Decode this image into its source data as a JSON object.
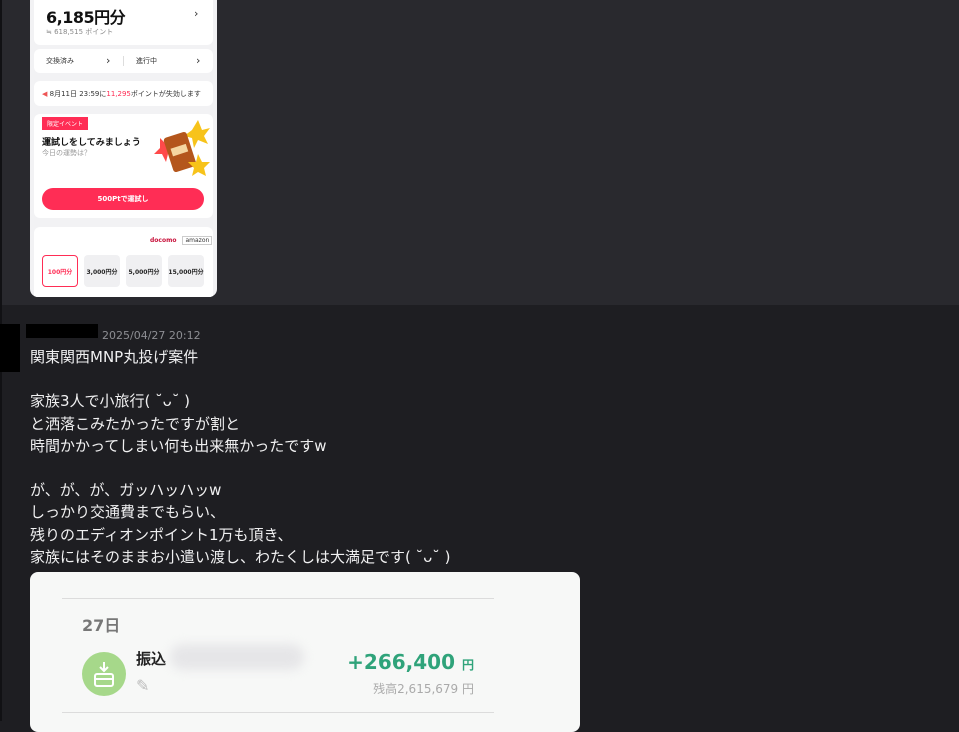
{
  "phone": {
    "balance_amount": "6,185円分",
    "balance_points": "≒ 618,515 ポイント",
    "exchanged_label": "交換済み",
    "in_progress_label": "進行中",
    "expiry_prefix": "8月11日 23:59に",
    "expiry_points": "11,295",
    "expiry_suffix": "ポイントが失効します",
    "event_tag": "限定イベント",
    "event_title": "運試しをしてみましょう",
    "event_sub": "今日の運勢は？",
    "event_button": "500Ptで運試し",
    "logo_docomo": "docomo",
    "logo_amazon": "amazon",
    "options": [
      "100円分",
      "3,000円分",
      "5,000円分",
      "15,000円分"
    ]
  },
  "message": {
    "timestamp": "2025/04/27 20:12",
    "lines": [
      "関東関西MNP丸投げ案件",
      "",
      "家族3人で小旅行( ˘ᴗ˘ )",
      "と洒落こみたかったですが割と",
      "時間かかってしまい何も出来無かったですw",
      "",
      "が、が、が、ガッハッハッw",
      "しっかり交通費までもらい、",
      "残りのエディオンポイント1万も頂き、",
      "家族にはそのままお小遣い渡し、わたくしは大満足です( ˘ᴗ˘ )"
    ]
  },
  "bank": {
    "day": "27日",
    "description": "振込",
    "amount": "+266,400",
    "amount_unit": "円",
    "balance": "残高2,615,679 円"
  }
}
